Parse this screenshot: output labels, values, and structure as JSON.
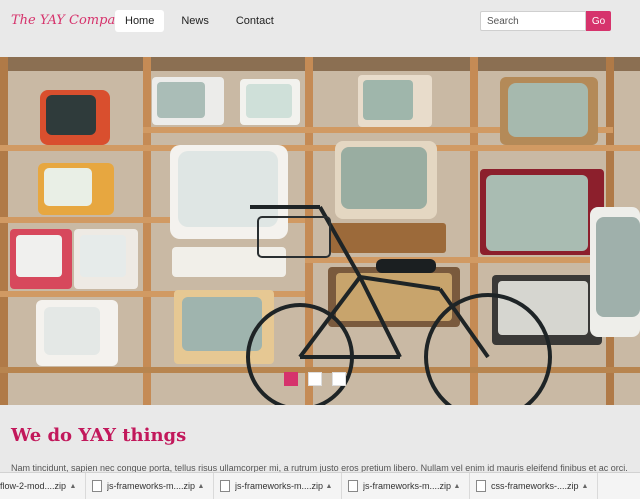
{
  "brand": {
    "name": "The YAY Company"
  },
  "nav": {
    "items": [
      {
        "label": "Home",
        "active": true
      },
      {
        "label": "News",
        "active": false
      },
      {
        "label": "Contact",
        "active": false
      }
    ]
  },
  "search": {
    "placeholder": "Search",
    "button_label": "Go"
  },
  "hero": {
    "slides": 3,
    "active_slide": 1
  },
  "content": {
    "headline": "We do YAY things",
    "lead": "Nam tincidunt, sapien nec congue porta, tellus risus ullamcorper mi, a rutrum justo eros pretium libero. Nullam vel enim id mauris eleifend finibus et ac orci."
  },
  "downloads": {
    "items": [
      {
        "name": "flow-2-mod....zip"
      },
      {
        "name": "js-frameworks-m....zip"
      },
      {
        "name": "js-frameworks-m....zip"
      },
      {
        "name": "js-frameworks-m....zip"
      },
      {
        "name": "css-frameworks-....zip"
      }
    ]
  },
  "colors": {
    "accent": "#d6336c",
    "heading": "#c2185b",
    "background": "#e9e9e9"
  }
}
